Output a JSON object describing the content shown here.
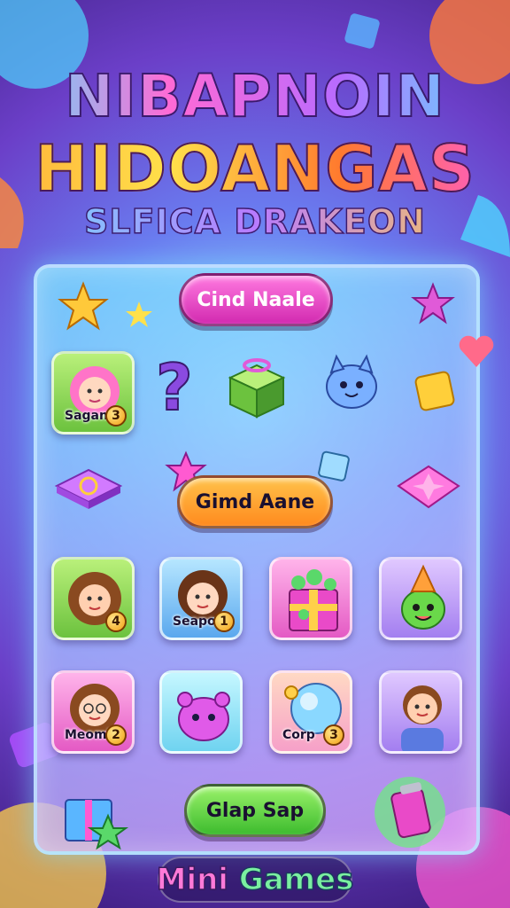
{
  "title": {
    "line1": "NIBAPNOIN",
    "line2": "HIDOANGAS",
    "line3": "SLFICA DRAKEON"
  },
  "buttons": {
    "top": "Cind Naale",
    "middle": "Gimd Aane",
    "bottom": "Glap Sap"
  },
  "tiles": {
    "row1_char": {
      "label": "Sagan",
      "badge": "3"
    },
    "row3_char1": {
      "badge": "4"
    },
    "row3_char2": {
      "label": "Seapoe",
      "badge": "1"
    },
    "row4_char1": {
      "label": "Meoml",
      "badge": "2"
    },
    "row4_orb": {
      "label": "Corp",
      "badge": "3"
    }
  },
  "footer": {
    "mini": "Mini",
    "games": "Games"
  },
  "colors": {
    "accent_pink": "#d22ab0",
    "accent_orange": "#ff8a1e",
    "accent_green": "#3dbb2e",
    "background": "#6b3fc8"
  },
  "icons": [
    "star-icon",
    "question-mark-icon",
    "gift-box-icon",
    "blob-creature-icon",
    "gem-icon",
    "heart-icon",
    "cube-icon",
    "party-creature-icon",
    "potion-icon"
  ]
}
